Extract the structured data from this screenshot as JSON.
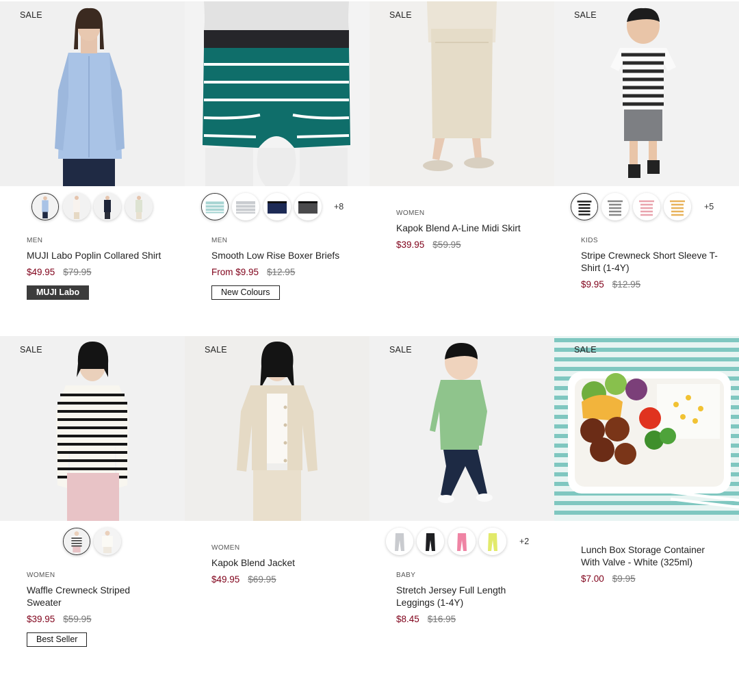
{
  "products": [
    {
      "sale": "SALE",
      "category": "MEN",
      "name": "MUJI Labo Poplin Collared Shirt",
      "price": "$49.95",
      "was": "$79.95",
      "badge": "MUJI Labo"
    },
    {
      "sale": "",
      "category": "MEN",
      "name": "Smooth Low Rise Boxer Briefs",
      "price": "From $9.95",
      "was": "$12.95",
      "badge": "New Colours",
      "more": "+8"
    },
    {
      "sale": "SALE",
      "category": "WOMEN",
      "name": "Kapok Blend A-Line Midi Skirt",
      "price": "$39.95",
      "was": "$59.95"
    },
    {
      "sale": "SALE",
      "category": "KIDS",
      "name": "Stripe Crewneck Short Sleeve T-Shirt (1-4Y)",
      "price": "$9.95",
      "was": "$12.95",
      "more": "+5"
    },
    {
      "sale": "SALE",
      "category": "WOMEN",
      "name": "Waffle Crewneck Striped Sweater",
      "price": "$39.95",
      "was": "$59.95",
      "badge": "Best Seller"
    },
    {
      "sale": "SALE",
      "category": "WOMEN",
      "name": "Kapok Blend Jacket",
      "price": "$49.95",
      "was": "$69.95"
    },
    {
      "sale": "SALE",
      "category": "BABY",
      "name": "Stretch Jersey Full Length Leggings (1-4Y)",
      "price": "$8.45",
      "was": "$16.95",
      "more": "+2"
    },
    {
      "sale": "SALE",
      "category": "",
      "name": "Lunch Box Storage Container With Valve - White (325ml)",
      "price": "$7.00",
      "was": "$9.95"
    }
  ],
  "colors": {
    "sale_price": "#7f0019",
    "badge_dark": "#3c3c3c"
  }
}
